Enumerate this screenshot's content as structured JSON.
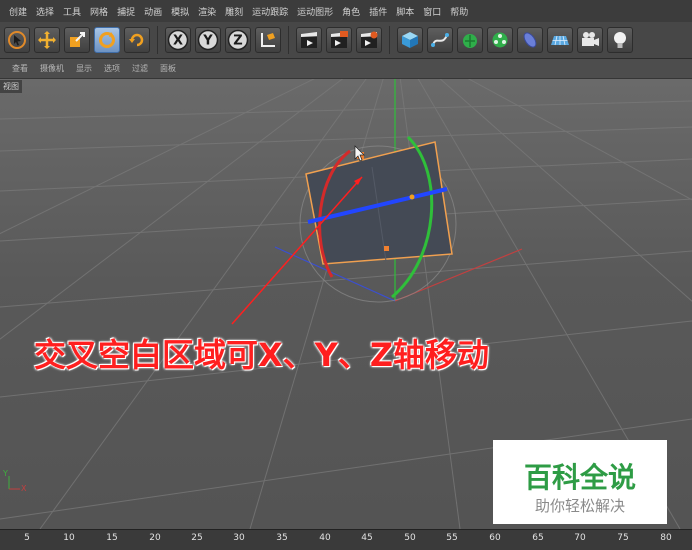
{
  "menubar": {
    "items": [
      "创建",
      "选择",
      "工具",
      "网格",
      "捕捉",
      "动画",
      "模拟",
      "渲染",
      "雕刻",
      "运动跟踪",
      "运动图形",
      "角色",
      "插件",
      "脚本",
      "窗口",
      "帮助"
    ]
  },
  "toolbar": {
    "buttons": [
      {
        "name": "select-tool-button",
        "icon": "arrow-cursor-icon"
      },
      {
        "name": "move-tool-button",
        "icon": "move-cross-icon"
      },
      {
        "name": "scale-tool-button",
        "icon": "scale-box-icon"
      },
      {
        "name": "rotate-tool-button",
        "icon": "rotate-icon",
        "active": true
      },
      {
        "name": "recent-tool-button",
        "icon": "cycle-icon"
      },
      {
        "name": "lock-x-button",
        "label": "X"
      },
      {
        "name": "lock-y-button",
        "label": "Y"
      },
      {
        "name": "lock-z-button",
        "label": "Z"
      },
      {
        "name": "coordinate-system-button",
        "icon": "world-axis-icon"
      },
      {
        "name": "render-view-button",
        "icon": "clapper-icon"
      },
      {
        "name": "render-picture-viewer-button",
        "icon": "clapper-render-icon"
      },
      {
        "name": "render-settings-button",
        "icon": "clapper-gear-icon"
      },
      {
        "name": "cube-button",
        "icon": "cube-icon"
      },
      {
        "name": "spline-pen-button",
        "icon": "pen-spline-icon"
      },
      {
        "name": "subdivision-button",
        "icon": "subdivision-icon"
      },
      {
        "name": "cloner-button",
        "icon": "cloner-icon"
      },
      {
        "name": "deformer-button",
        "icon": "deformer-icon"
      },
      {
        "name": "floor-button",
        "icon": "floor-grid-icon"
      },
      {
        "name": "camera-button",
        "icon": "camera-icon"
      },
      {
        "name": "light-button",
        "icon": "light-bulb-icon"
      }
    ]
  },
  "submenu": {
    "items": [
      "查看",
      "摄像机",
      "显示",
      "选项",
      "过滤",
      "面板"
    ]
  },
  "viewport": {
    "label": "视图",
    "caption": "交叉空白区域可X、Y、Z轴移动",
    "axis_labels": {
      "y": "Y",
      "x": "X"
    }
  },
  "timeline": {
    "ticks": [
      "5",
      "10",
      "15",
      "20",
      "25",
      "30",
      "35",
      "40",
      "45",
      "50",
      "55",
      "60",
      "65",
      "70",
      "75",
      "80"
    ]
  },
  "watermark": {
    "title": "百科全说",
    "subtitle": "助你轻松解决"
  },
  "colors": {
    "x_axis": "#e02a2a",
    "y_axis": "#2fbf3a",
    "z_axis": "#2040e8",
    "caption": "#ff1f1f",
    "watermark_title": "#2e9c45"
  }
}
